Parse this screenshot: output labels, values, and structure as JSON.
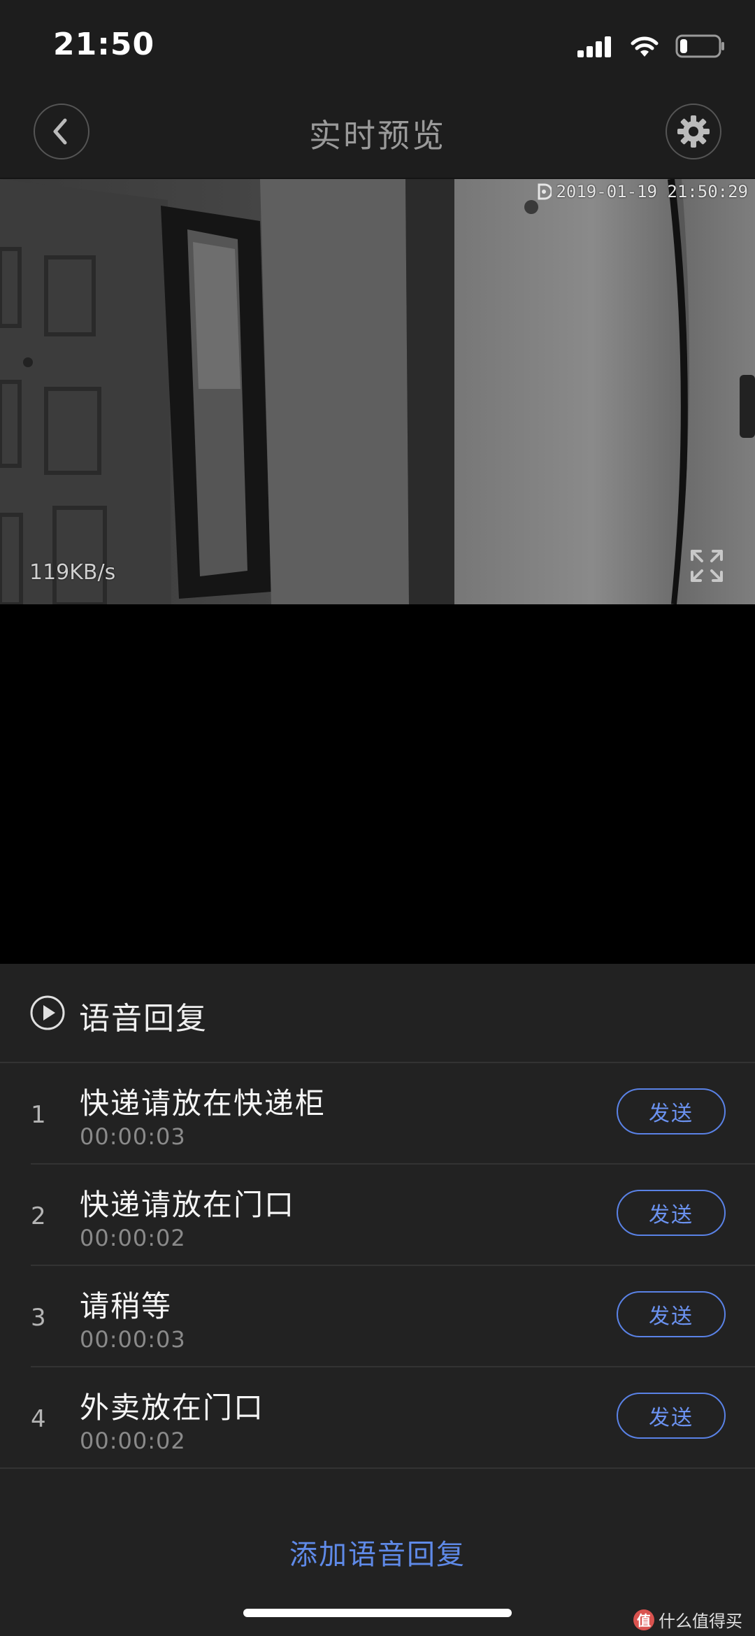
{
  "status_bar": {
    "time": "21:50",
    "signal_icon": "signal-bars-icon",
    "wifi_icon": "wifi-icon",
    "battery_icon": "battery-icon",
    "battery_level": 0.2
  },
  "nav": {
    "back_icon": "chevron-left-icon",
    "title": "实时预览",
    "settings_icon": "gear-icon"
  },
  "video": {
    "timestamp": "2019-01-19 21:50:29",
    "bitrate": "119KB/s",
    "fullscreen_icon": "fullscreen-icon"
  },
  "voice_reply": {
    "header_icon": "play-circle-icon",
    "title": "语音回复",
    "items": [
      {
        "index": "1",
        "text": "快递请放在快递柜",
        "duration": "00:00:03",
        "send_label": "发送"
      },
      {
        "index": "2",
        "text": "快递请放在门口",
        "duration": "00:00:02",
        "send_label": "发送"
      },
      {
        "index": "3",
        "text": "请稍等",
        "duration": "00:00:03",
        "send_label": "发送"
      },
      {
        "index": "4",
        "text": "外卖放在门口",
        "duration": "00:00:02",
        "send_label": "发送"
      }
    ],
    "add_label": "添加语音回复"
  },
  "watermark": {
    "text": "什么值得买",
    "logo_char": "值"
  },
  "colors": {
    "accent": "#5f8ae8",
    "panel_bg": "#222222",
    "bar_bg": "#1d1d1d"
  }
}
